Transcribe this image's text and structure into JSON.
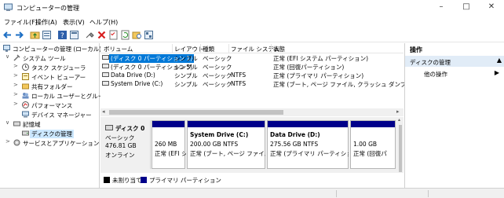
{
  "window": {
    "title": "コンピューターの管理",
    "controls": [
      "minimize",
      "maximize",
      "close"
    ]
  },
  "menu": [
    "ファイル(F)",
    "操作(A)",
    "表示(V)",
    "ヘルプ(H)"
  ],
  "toolbar_icons": [
    "back-arrow-icon",
    "forward-arrow-icon",
    "up-folder-icon",
    "properties-icon",
    "help-icon",
    "console-icon",
    "connect-icon",
    "delete-icon",
    "checklist-icon",
    "refresh-icon",
    "folder-search-icon",
    "properties-sheet-icon"
  ],
  "tree": {
    "root": "コンピューターの管理 (ローカル)",
    "system_tools": "システム ツール",
    "task_scheduler": "タスク スケジューラ",
    "event_viewer": "イベント ビューアー",
    "shared_folders": "共有フォルダー",
    "local_users": "ローカル ユーザーとグループ",
    "performance": "パフォーマンス",
    "device_manager": "デバイス マネージャー",
    "storage": "記憶域",
    "disk_management": "ディスクの管理",
    "services": "サービスとアプリケーション"
  },
  "volumes": {
    "headers": [
      "ボリューム",
      "レイアウト",
      "種類",
      "ファイル システム",
      "状態"
    ],
    "rows": [
      {
        "name": "(ディスク 0 パーティション 1)",
        "layout": "シンプル",
        "type": "ベーシック",
        "fs": "",
        "status": "正常 (EFI システム パーティション)"
      },
      {
        "name": "(ディスク 0 パーティション 5)",
        "layout": "シンプル",
        "type": "ベーシック",
        "fs": "",
        "status": "正常 (回復パーティション)"
      },
      {
        "name": "Data Drive (D:)",
        "layout": "シンプル",
        "type": "ベーシック",
        "fs": "NTFS",
        "status": "正常 (プライマリ パーティション)"
      },
      {
        "name": "System Drive (C:)",
        "layout": "シンプル",
        "type": "ベーシック",
        "fs": "NTFS",
        "status": "正常 (ブート, ページ ファイル, クラッシュ ダンプ, プライマリ パ"
      }
    ]
  },
  "disk": {
    "name": "ディスク 0",
    "type": "ベーシック",
    "size": "476.81 GB",
    "state": "オンライン",
    "partitions": [
      {
        "line1": "",
        "line2": "260 MB",
        "line3": "正常 (EFI シ"
      },
      {
        "line1": "System Drive  (C:)",
        "line2": "200.00 GB NTFS",
        "line3": "正常 (ブート, ページ ファイル, ク"
      },
      {
        "line1": "Data Drive  (D:)",
        "line2": "275.56 GB NTFS",
        "line3": "正常 (プライマリ パーティション)"
      },
      {
        "line1": "",
        "line2": "1.00 GB",
        "line3": "正常 (回復パ"
      }
    ]
  },
  "legend": {
    "unallocated": "未割り当て",
    "primary": "プライマリ パーティション",
    "unallocated_color": "#000000",
    "primary_color": "#00008a"
  },
  "actions": {
    "header": "操作",
    "section": "ディスクの管理",
    "other": "他の操作"
  }
}
